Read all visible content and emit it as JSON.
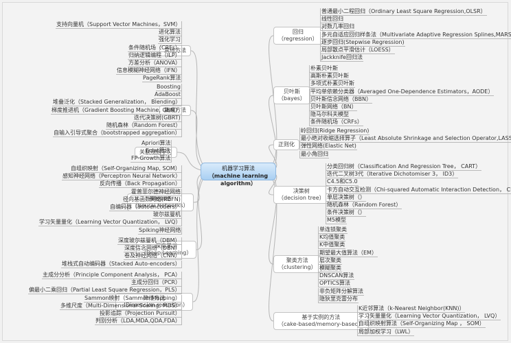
{
  "root": {
    "title": "机器学习算法",
    "subtitle": "（machine learning algorithm）"
  },
  "left": [
    {
      "label": "其他方法",
      "sublabel": "",
      "items": [
        "支持向量机（Support Vector Machines，SVM）",
        "进化算法",
        "强化学习",
        "条件随机场（CRFs）",
        "归纳逻辑编程（ILP）",
        "方差分析（ANOVA）",
        "信息模糊神经网络（IFN）",
        "PageRank算法"
      ]
    },
    {
      "label": "集成方法",
      "sublabel": "",
      "items": [
        "Boosting",
        "AdaBoost",
        "堆叠泛化（Stacked Generalization， Blending）",
        "梯度推进机（Gradient Boosting Machine, GBM）",
        "迭代决策树(GBRT)",
        "随机森林（Random Forest）",
        "自输入引导式聚合（bootstrapped aggregation）"
      ]
    },
    {
      "label": "关联规则学习",
      "sublabel": "",
      "items": [
        "Apriori算法",
        "Eclat算法",
        "FP-Growth算法"
      ]
    },
    {
      "label": "神经网络",
      "sublabel": "（Neural Networks）",
      "items": [
        "自组织映射（Self-Organizing Map, SOM）",
        "感知神经网络（Perceptron Neural Network）",
        "反向传播（Back Propagation）",
        "霍普菲尔德神经网络",
        "径向基函数网络(RBFN)",
        "自编码器（autoencoders）",
        "玻尔兹曼机",
        "学习矢量量化（Learning Vector Quantization， LVQ）",
        "Spiking神经网络"
      ]
    },
    {
      "label": "深度学习",
      "sublabel": "（Deep Learning）",
      "items": [
        "深度玻尔兹曼机（DBM）",
        "深度信念网络（DBN）",
        "卷及神经网络（CNN）",
        "堆栈式自动编码器（Stacked Auto-encoders）"
      ]
    },
    {
      "label": "降维方法",
      "sublabel": "（Dimension reduction）",
      "items": [
        "主成分分析（Principle Component Analysis， PCA）",
        "主成分回归（PCR）",
        "偏最小二乘回归（Partial Least Square Regression，PLS）",
        "Sammon映射（Sammon Mapping）",
        "多维尺度（Multi-Dimensional Scaling, MDS）",
        "投影追踪（Projection Pursuit）",
        "判别分析（LDA,MDA,QDA,FDA）"
      ]
    }
  ],
  "right": [
    {
      "label": "回归",
      "sublabel": "（regression）",
      "items": [
        "普通最小二程回归（Ordinary Least Square Regression,OLSR）",
        "线性回归",
        "对数几率回归",
        "多元自适应回归样条法（Multivariate Adaptive Regression Splines,MARS）",
        "逐步回归(Stepwise Regression)",
        "局部散点平滑估计（LOESS）",
        "Jackknife回归法"
      ]
    },
    {
      "label": "贝叶斯",
      "sublabel": "（bayes）",
      "items": [
        "朴素贝叶斯",
        "高斯朴素贝叶斯",
        "多项式朴素贝叶斯",
        "平均单依赖分类器（Averaged One-Dependence Estimators，AODE）",
        "贝叶斯信念网络（BBN）",
        "贝叶斯网络（BN）",
        "隐马尔科夫模型",
        "条件随机场（CRFs）"
      ]
    },
    {
      "label": "正则化",
      "sublabel": "",
      "items": [
        "岭回归(Ridge Regression)",
        "最小绝对收缩选择算子（Least Absolute Shrinkage and Selection Operator,LASSO）",
        "弹性网络(Elastic Net)",
        "最小角回归"
      ]
    },
    {
      "label": "决策树",
      "sublabel": "（decision tree）",
      "items": [
        "分类回归树（Classification And Regression Tree， CART）",
        "迭代二叉树3代（Iterative Dichotomiser 3， ID3）",
        "C4.5和C5.0",
        "卡方自动交互检测（Chi-squared Automatic Interaction Detection， CHAID）",
        "单层决策树（）",
        "随机森林（Random Forest）",
        "条件决策树（）",
        "M5模型"
      ]
    },
    {
      "label": "聚类方法",
      "sublabel": "（clustering）",
      "items": [
        "单连锁聚类",
        "K均值聚类",
        "K中值聚类",
        "期望最大值算法（EM）",
        "层次聚类",
        "模糊聚类",
        "DNSCAN算法",
        "OPTICS算法",
        "非负矩阵分解算法",
        "隐狄里克雷分布"
      ]
    },
    {
      "label": "基于实例的方法",
      "sublabel": "（cake-based/memory-based）",
      "items": [
        "K近邻算法（k-Nearest Neighbor(KNN)）",
        "学习矢量量化（Learning Vector Quantization， LVQ）",
        "自组织映射算法（Self-Organizing Map ， SOM）",
        "局部加权学习（LWL）"
      ]
    }
  ]
}
